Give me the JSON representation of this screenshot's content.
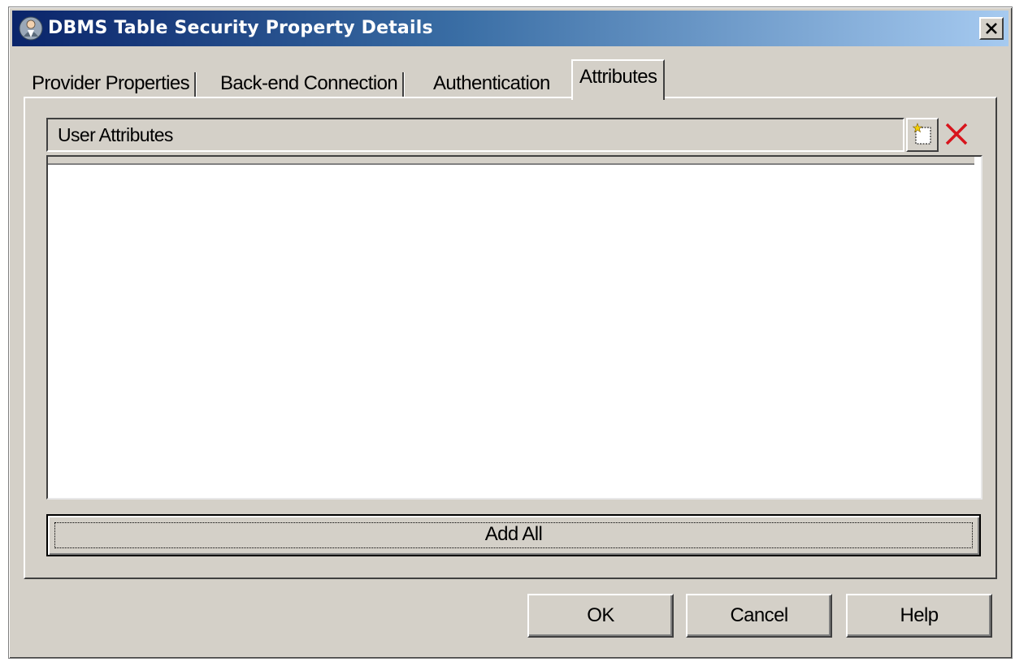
{
  "window": {
    "title": "DBMS Table Security Property Details"
  },
  "tabs": [
    {
      "label": "Provider Properties",
      "active": false
    },
    {
      "label": "Back-end Connection",
      "active": false
    },
    {
      "label": "Authentication",
      "active": false
    },
    {
      "label": "Attributes",
      "active": true
    }
  ],
  "attributes_panel": {
    "list_header": "User Attributes",
    "add_all_label": "Add All"
  },
  "buttons": {
    "ok": "OK",
    "cancel": "Cancel",
    "help": "Help"
  },
  "icons": {
    "title": "user-security-icon",
    "close": "close-icon",
    "new": "new-item-icon",
    "delete": "delete-icon"
  },
  "colors": {
    "title_gradient_start": "#0a246a",
    "title_gradient_end": "#a6caf0",
    "dialog_face": "#d4d0c8",
    "delete_red": "#d8141c"
  }
}
